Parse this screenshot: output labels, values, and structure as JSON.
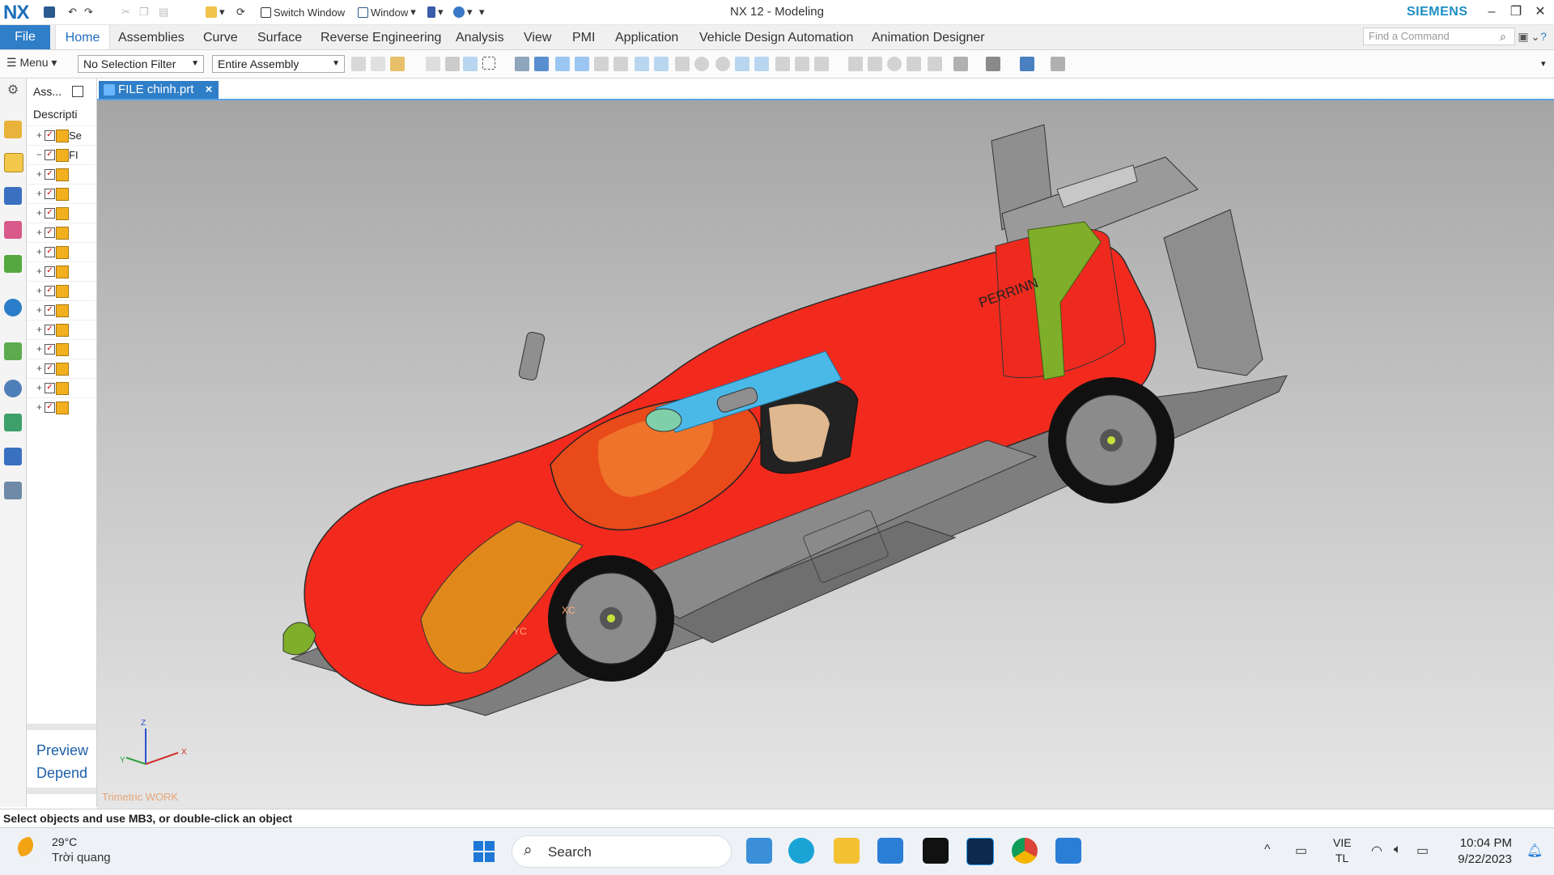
{
  "app": {
    "logo": "NX",
    "window_title": "NX 12 - Modeling",
    "brand": "SIEMENS",
    "quick_access": {
      "switch_window": "Switch Window",
      "window": "Window"
    }
  },
  "ribbon": {
    "file": "File",
    "tabs": [
      "Home",
      "Assemblies",
      "Curve",
      "Surface",
      "Reverse Engineering",
      "Analysis",
      "View",
      "PMI",
      "Application",
      "Vehicle Design Automation",
      "Animation Designer"
    ],
    "active_tab": "Home",
    "find_command_placeholder": "Find a Command"
  },
  "toolbar": {
    "menu": "Menu",
    "selection_filter": "No Selection Filter",
    "scope": "Entire Assembly"
  },
  "navigator": {
    "title": "Ass...",
    "column_header": "Descripti",
    "rows": [
      {
        "expand": "+",
        "label": "Se"
      },
      {
        "expand": "−",
        "label": "FI"
      },
      {
        "expand": "+",
        "label": ""
      },
      {
        "expand": "+",
        "label": ""
      },
      {
        "expand": "+",
        "label": ""
      },
      {
        "expand": "+",
        "label": ""
      },
      {
        "expand": "+",
        "label": ""
      },
      {
        "expand": "+",
        "label": ""
      },
      {
        "expand": "+",
        "label": ""
      },
      {
        "expand": "+",
        "label": ""
      },
      {
        "expand": "+",
        "label": ""
      },
      {
        "expand": "+",
        "label": ""
      },
      {
        "expand": "+",
        "label": ""
      },
      {
        "expand": "+",
        "label": ""
      },
      {
        "expand": "+",
        "label": ""
      }
    ],
    "preview": "Preview",
    "depend": "Depend"
  },
  "document": {
    "tab": "FILE chinh.prt",
    "close": "×",
    "view_label": "Trimetric WORK",
    "car_brand_text": "PERRINN",
    "triad": {
      "x": "X",
      "y": "Y",
      "z": "Z",
      "wcs_x": "XC",
      "wcs_y": "YC"
    }
  },
  "status": {
    "message": "Select objects and use MB3, or double-click an object"
  },
  "taskbar": {
    "weather_temp": "29°C",
    "weather_desc": "Trời quang",
    "search": "Search",
    "lang_top": "VIE",
    "lang_bottom": "TL",
    "time": "10:04 PM",
    "date": "9/22/2023"
  },
  "colors": {
    "accent": "#2f7ec8",
    "car_body": "#f22a1e",
    "car_accent_blue": "#4bb9e8",
    "car_accent_green": "#7fae2a",
    "car_accent_orange": "#e0891a",
    "car_gray": "#8d8d8d"
  }
}
